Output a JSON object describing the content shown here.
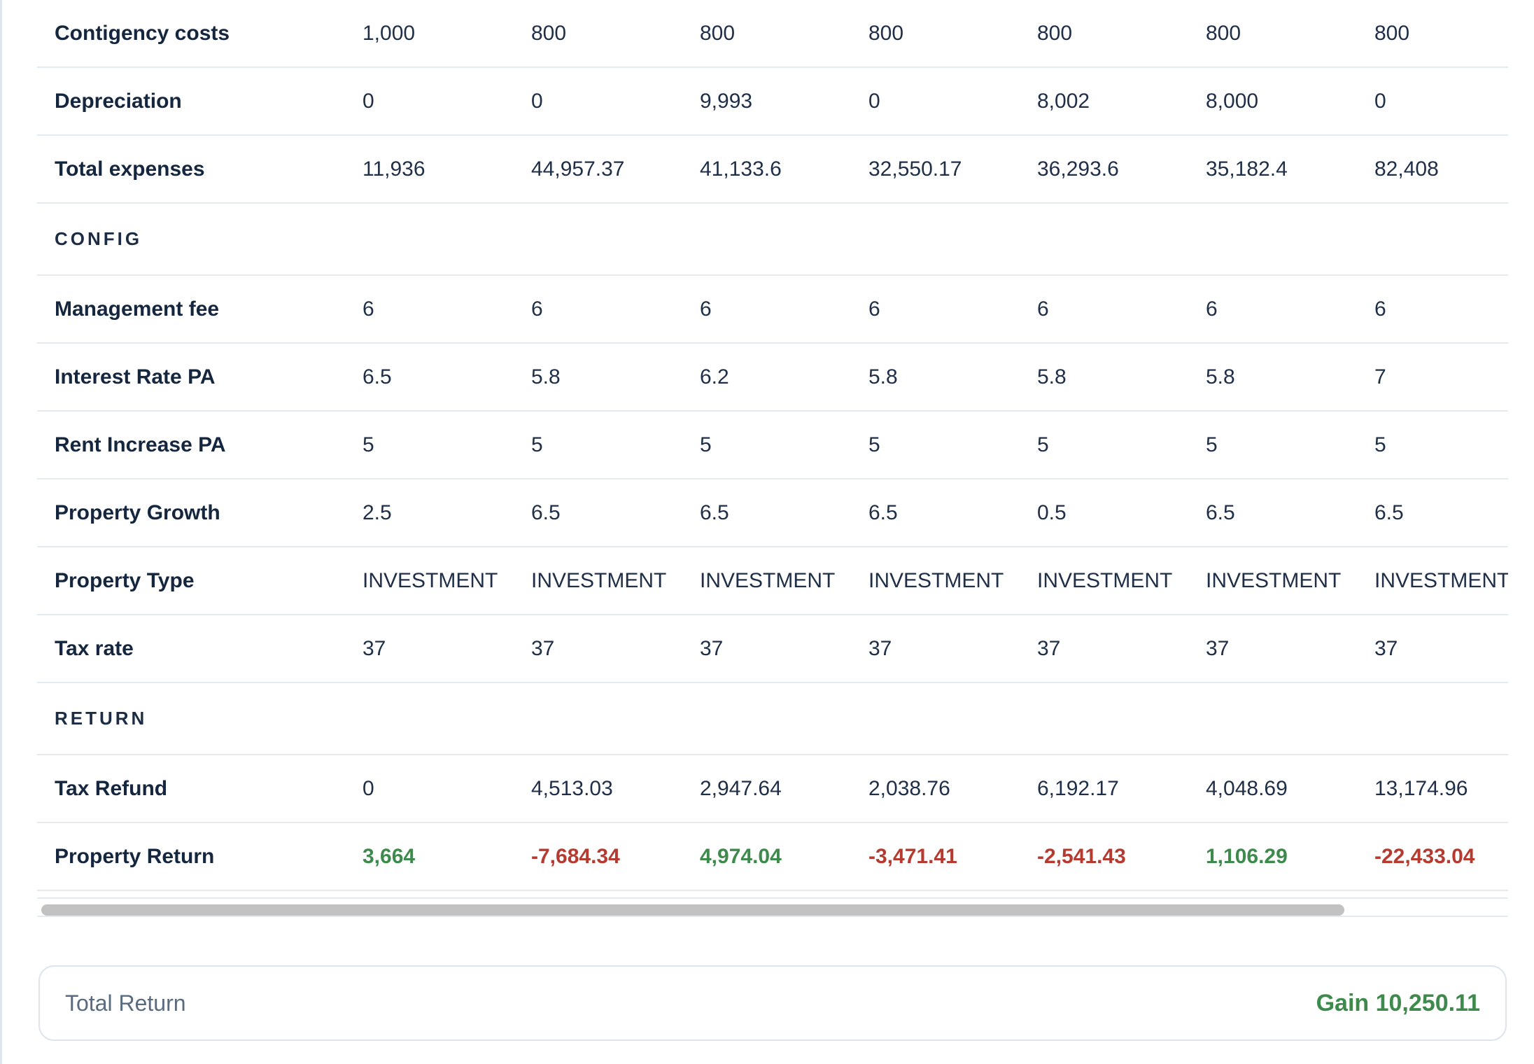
{
  "colors": {
    "positive": "#3d8a4c",
    "negative": "#b53a2f"
  },
  "rows": [
    {
      "type": "data",
      "label": "Contigency costs",
      "values": [
        "1,000",
        "800",
        "800",
        "800",
        "800",
        "800",
        "800"
      ]
    },
    {
      "type": "data",
      "label": "Depreciation",
      "values": [
        "0",
        "0",
        "9,993",
        "0",
        "8,002",
        "8,000",
        "0"
      ]
    },
    {
      "type": "data",
      "label": "Total expenses",
      "values": [
        "11,936",
        "44,957.37",
        "41,133.6",
        "32,550.17",
        "36,293.6",
        "35,182.4",
        "82,408"
      ]
    },
    {
      "type": "section",
      "label": "CONFIG"
    },
    {
      "type": "data",
      "label": "Management fee",
      "values": [
        "6",
        "6",
        "6",
        "6",
        "6",
        "6",
        "6"
      ]
    },
    {
      "type": "data",
      "label": "Interest Rate PA",
      "values": [
        "6.5",
        "5.8",
        "6.2",
        "5.8",
        "5.8",
        "5.8",
        "7"
      ]
    },
    {
      "type": "data",
      "label": "Rent Increase PA",
      "values": [
        "5",
        "5",
        "5",
        "5",
        "5",
        "5",
        "5"
      ]
    },
    {
      "type": "data",
      "label": "Property Growth",
      "values": [
        "2.5",
        "6.5",
        "6.5",
        "6.5",
        "0.5",
        "6.5",
        "6.5"
      ]
    },
    {
      "type": "data",
      "label": "Property Type",
      "values": [
        "INVESTMENT",
        "INVESTMENT",
        "INVESTMENT",
        "INVESTMENT",
        "INVESTMENT",
        "INVESTMENT",
        "INVESTMENT"
      ]
    },
    {
      "type": "data",
      "label": "Tax rate",
      "values": [
        "37",
        "37",
        "37",
        "37",
        "37",
        "37",
        "37"
      ]
    },
    {
      "type": "section",
      "label": "RETURN"
    },
    {
      "type": "data",
      "label": "Tax Refund",
      "values": [
        "0",
        "4,513.03",
        "2,947.64",
        "2,038.76",
        "6,192.17",
        "4,048.69",
        "13,174.96"
      ]
    },
    {
      "type": "data",
      "label": "Property Return",
      "values": [
        "3,664",
        "-7,684.34",
        "4,974.04",
        "-3,471.41",
        "-2,541.43",
        "1,106.29",
        "-22,433.04"
      ],
      "signed": true
    }
  ],
  "total": {
    "label": "Total Return",
    "value": "Gain 10,250.11"
  }
}
